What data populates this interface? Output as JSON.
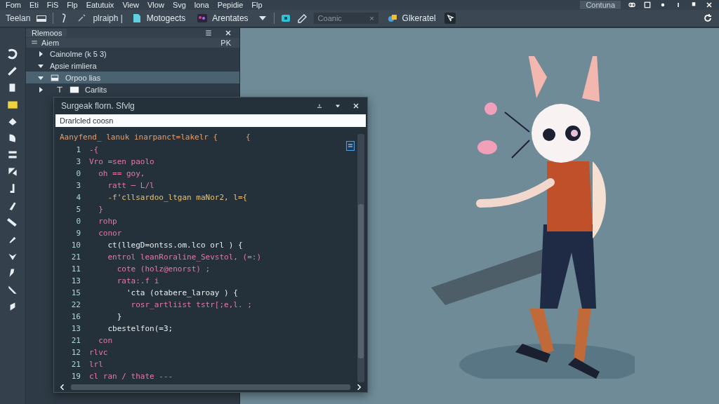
{
  "menu": {
    "items": [
      "Fom",
      "Eti",
      "FiS",
      "Flp",
      "Eatutuix",
      "View",
      "Vlow",
      "Svg",
      "lona",
      "Pepidie",
      "Flp"
    ],
    "right_button": "Contuna"
  },
  "toolbar": {
    "label": "Teelan",
    "mode": "plraiph |",
    "object_button": "Motogects",
    "animate_button": "Arentates",
    "search": {
      "value": "Coanic",
      "clear": "×"
    },
    "generate_button": "Glkeratel"
  },
  "layers": {
    "tab": "Rlemoos",
    "header": "Aiem",
    "header_right": "PK",
    "tree": [
      {
        "label": "Cainolme (k 5 3)",
        "expanded": false,
        "selected": false
      },
      {
        "label": "Apsie rimliera",
        "expanded": true,
        "selected": false,
        "children": [
          {
            "label": "Orpoo lias",
            "expanded": true,
            "selected": true,
            "children": [
              {
                "label": "Carlits",
                "expanded": false,
                "selected": false
              }
            ]
          }
        ]
      }
    ]
  },
  "code_window": {
    "title": "Surgeak florn. Sfvlg",
    "field": {
      "value": "Drarlcled coosn"
    },
    "header_line": "Aanyfend_ lanuk inarpanct=lakelr {      {",
    "lines": [
      {
        "number": "1",
        "code": "-{",
        "kind": "keyword"
      },
      {
        "number": "3",
        "code": "Vro =sen paolo",
        "kind": "keyword"
      },
      {
        "number": "0",
        "code": "  oh == goy,",
        "kind": "keyword"
      },
      {
        "number": "3",
        "code": "    ratt ─ L/l",
        "kind": "keyword"
      },
      {
        "number": "4",
        "code": "    -f'cllsardoo_ltgan maNor2, l={",
        "kind": "string"
      },
      {
        "number": "5",
        "code": "  }",
        "kind": "keyword"
      },
      {
        "number": "0",
        "code": "  rohp",
        "kind": "keyword"
      },
      {
        "number": "9",
        "code": "  conor",
        "kind": "keyword"
      },
      {
        "number": "10",
        "code": "    ct(llegD=ontss.om.lco orl ) {",
        "kind": "plain"
      },
      {
        "number": "21",
        "code": "    entrol leanRoraline_Sevstol, (=:)",
        "kind": "keyword"
      },
      {
        "number": "11",
        "code": "      cote (holz@enorst) ;",
        "kind": "keyword"
      },
      {
        "number": "13",
        "code": "      rata:.f i",
        "kind": "keyword"
      },
      {
        "number": "15",
        "code": "        'cta (otabere_laroay ) {",
        "kind": "plain"
      },
      {
        "number": "22",
        "code": "         rosr_artliist tstr[;e,l. ;",
        "kind": "keyword"
      },
      {
        "number": "16",
        "code": "      }",
        "kind": "plain"
      },
      {
        "number": "13",
        "code": "    cbestelfon(=3;",
        "kind": "plain"
      },
      {
        "number": "21",
        "code": "  con",
        "kind": "keyword"
      },
      {
        "number": "12",
        "code": "rlvc",
        "kind": "keyword"
      },
      {
        "number": "21",
        "code": "lrl",
        "kind": "keyword"
      },
      {
        "number": "19",
        "code": "cl ran / thate ---",
        "kind": "keyword"
      }
    ]
  }
}
